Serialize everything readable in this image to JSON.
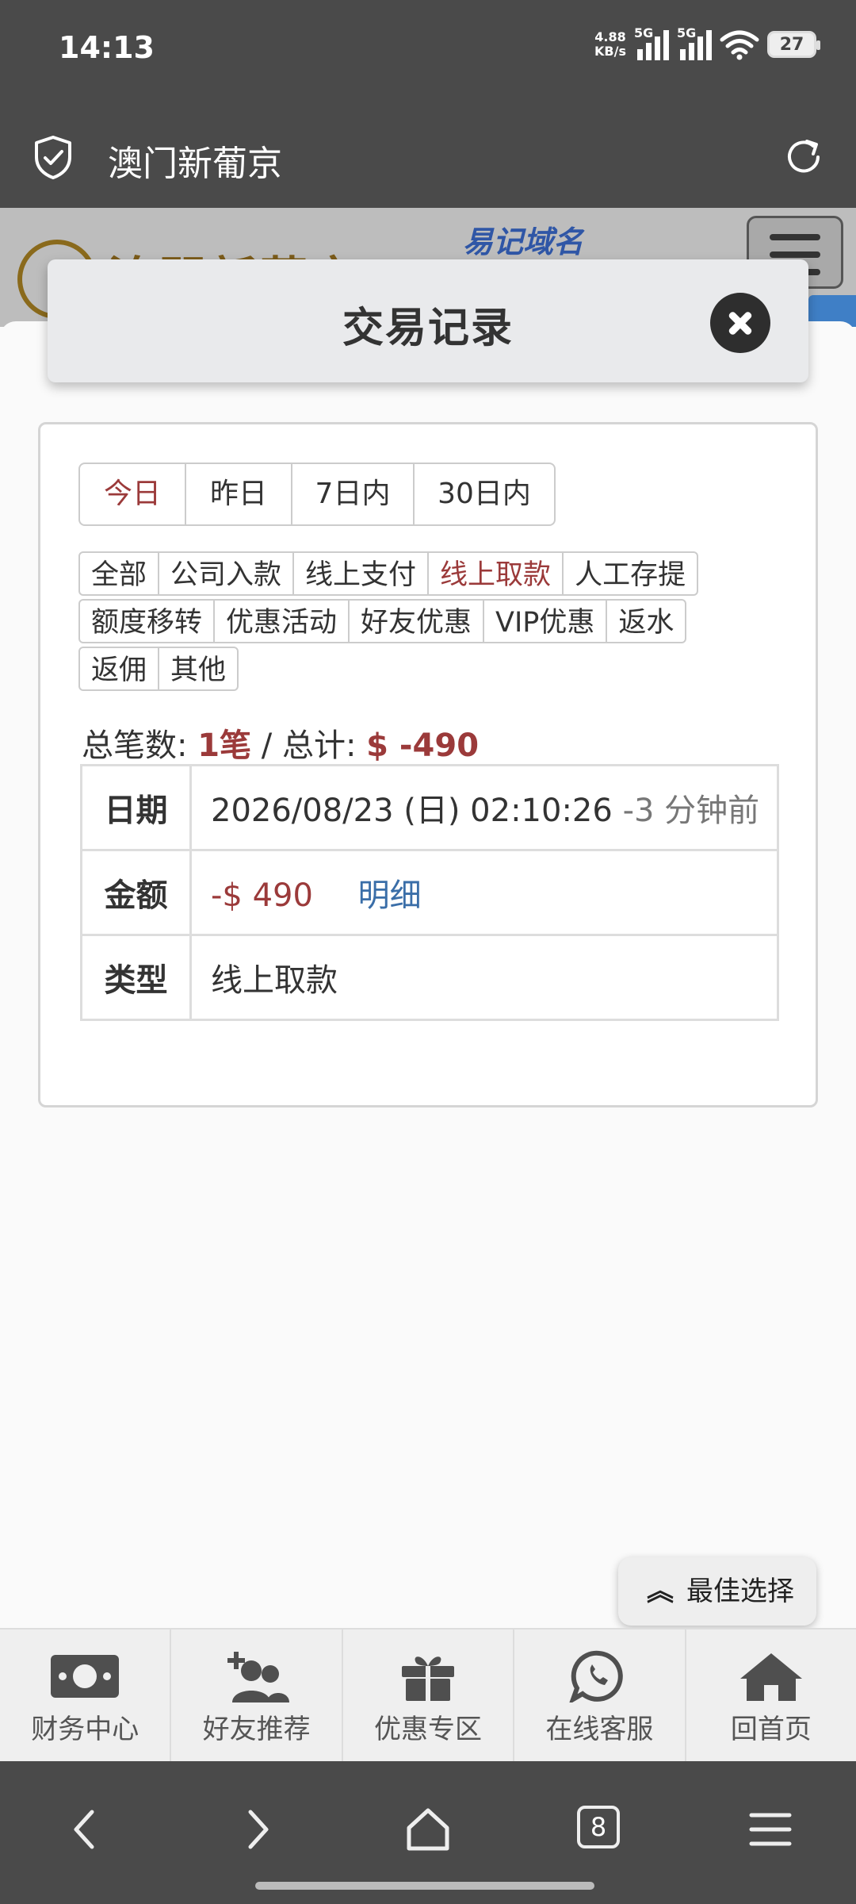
{
  "status_bar": {
    "time": "14:13",
    "net_speed_value": "4.88",
    "net_speed_unit": "KB/s",
    "network_type_1": "5G",
    "network_type_2": "5G",
    "battery": "27"
  },
  "browser": {
    "page_title": "澳门新葡京",
    "tab_count": "8"
  },
  "site_header": {
    "logo_text": "澳門新葡京",
    "domain_link": "易记域名"
  },
  "modal": {
    "title": "交易记录",
    "period_tabs": [
      {
        "label": "今日",
        "active": true
      },
      {
        "label": "昨日",
        "active": false
      },
      {
        "label": "7日内",
        "active": false
      },
      {
        "label": "30日内",
        "active": false
      }
    ],
    "type_filters": [
      {
        "label": "全部",
        "active": false
      },
      {
        "label": "公司入款",
        "active": false
      },
      {
        "label": "线上支付",
        "active": false
      },
      {
        "label": "线上取款",
        "active": true
      },
      {
        "label": "人工存提",
        "active": false
      },
      {
        "label": "额度移转",
        "active": false
      },
      {
        "label": "优惠活动",
        "active": false
      },
      {
        "label": "好友优惠",
        "active": false
      },
      {
        "label": "VIP优惠",
        "active": false
      },
      {
        "label": "返水",
        "active": false
      },
      {
        "label": "返佣",
        "active": false
      },
      {
        "label": "其他",
        "active": false
      }
    ],
    "summary": {
      "count_label": "总笔数:",
      "count_value": "1笔",
      "separator": "/",
      "total_label": "总计:",
      "total_value": "$ -490"
    },
    "record": {
      "date_label": "日期",
      "date_value": "2026/08/23 (日) 02:10:26",
      "date_relative": "-3 分钟前",
      "amount_label": "金额",
      "amount_value": "-$ 490",
      "detail_link": "明细",
      "type_label": "类型",
      "type_value": "线上取款"
    }
  },
  "best_choice_button": "最佳选择",
  "bottom_nav": [
    {
      "label": "财务中心",
      "icon": "money-icon"
    },
    {
      "label": "好友推荐",
      "icon": "add-friend-icon"
    },
    {
      "label": "优惠专区",
      "icon": "gift-icon"
    },
    {
      "label": "在线客服",
      "icon": "whatsapp-icon"
    },
    {
      "label": "回首页",
      "icon": "home-icon"
    }
  ],
  "colors": {
    "accent_red": "#9b3a3a",
    "link_blue": "#3a6ea8",
    "bar_dark": "#4a4a4a"
  }
}
